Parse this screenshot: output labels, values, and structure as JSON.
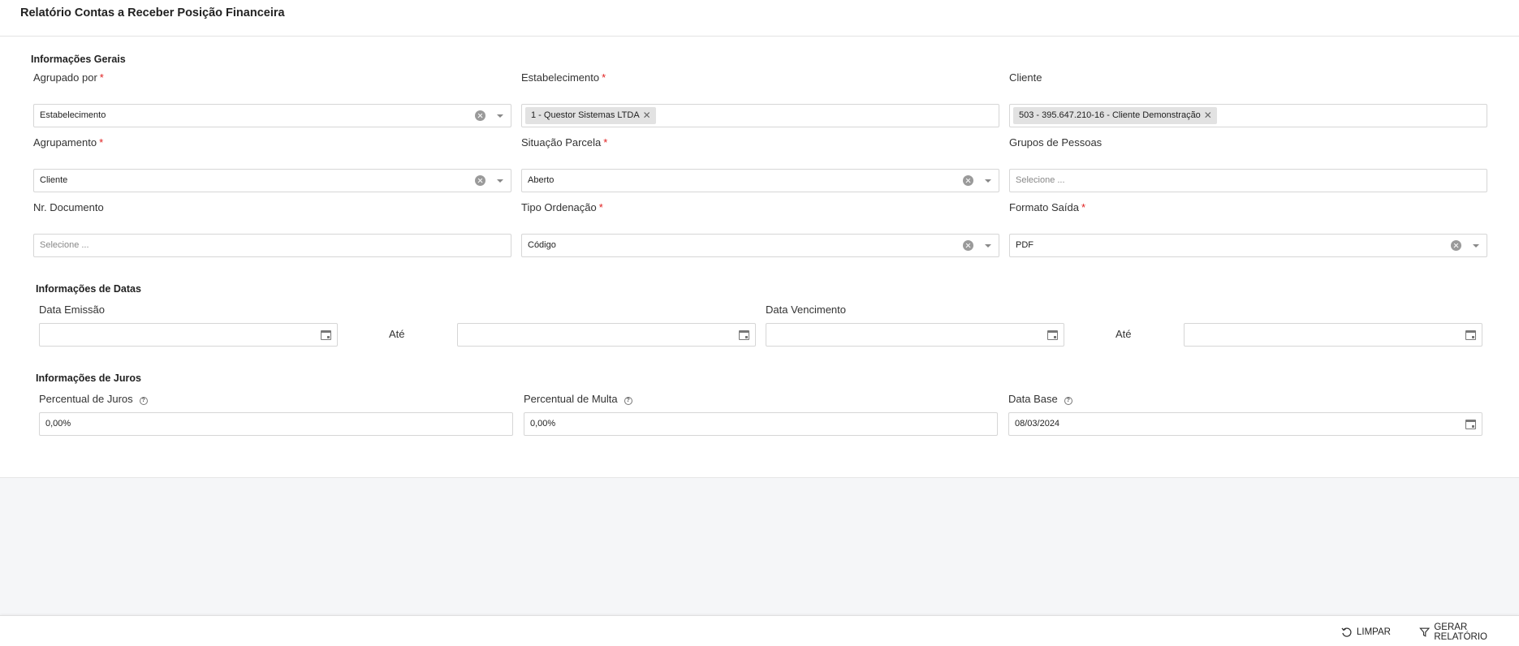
{
  "header": {
    "title": "Relatório Contas a Receber Posição Financeira"
  },
  "sections": {
    "general": "Informações Gerais",
    "dates": "Informações de Datas",
    "interest": "Informações de Juros"
  },
  "fields": {
    "agrupado_por": {
      "label": "Agrupado por",
      "required": "*",
      "value": "Estabelecimento"
    },
    "estabelecimento": {
      "label": "Estabelecimento",
      "required": "*",
      "chip": "1 - Questor Sistemas LTDA"
    },
    "cliente": {
      "label": "Cliente",
      "chip": "503 - 395.647.210-16 - Cliente Demonstração"
    },
    "agrupamento": {
      "label": "Agrupamento",
      "required": "*",
      "value": "Cliente"
    },
    "situacao_parcela": {
      "label": "Situação Parcela",
      "required": "*",
      "value": "Aberto"
    },
    "grupos_pessoas": {
      "label": "Grupos de Pessoas",
      "placeholder": "Selecione ..."
    },
    "nr_documento": {
      "label": "Nr. Documento",
      "placeholder": "Selecione ..."
    },
    "tipo_ordenacao": {
      "label": "Tipo Ordenação",
      "required": "*",
      "value": "Código"
    },
    "formato_saida": {
      "label": "Formato Saída",
      "required": "*",
      "value": "PDF"
    },
    "data_emissao": {
      "label": "Data Emissão",
      "from": "",
      "to_label": "Até",
      "to": ""
    },
    "data_vencimento": {
      "label": "Data Vencimento",
      "from": "",
      "to_label": "Até",
      "to": ""
    },
    "percentual_juros": {
      "label": "Percentual de Juros",
      "value": "0,00%"
    },
    "percentual_multa": {
      "label": "Percentual de Multa",
      "value": "0,00%"
    },
    "data_base": {
      "label": "Data Base",
      "value": "08/03/2024"
    }
  },
  "footer": {
    "clear_label": "LIMPAR",
    "generate_label": "GERAR RELATÓRIO"
  }
}
